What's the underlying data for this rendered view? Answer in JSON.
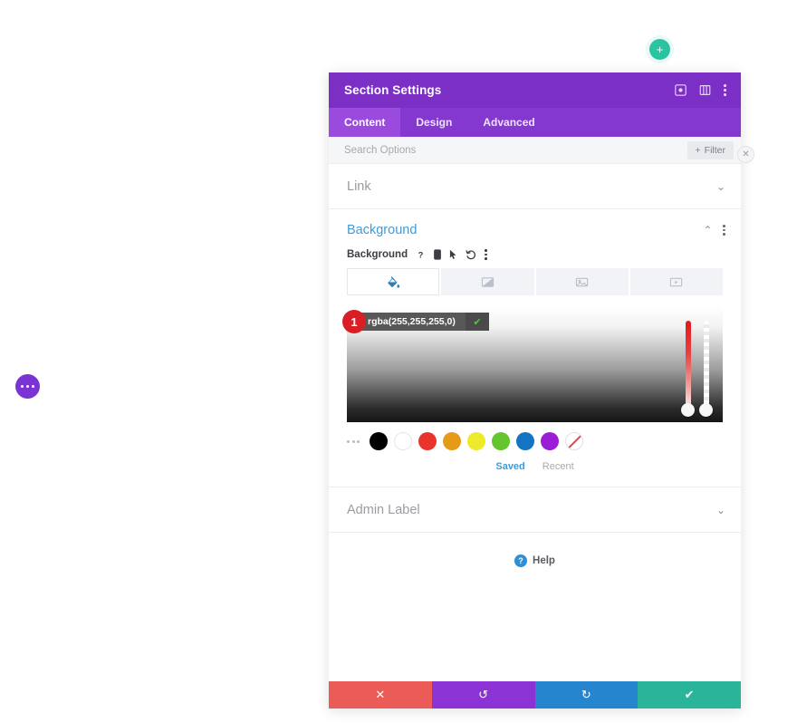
{
  "canvas": {
    "add_section_button": "+",
    "page_settings_button": "•••"
  },
  "modal": {
    "title": "Section Settings",
    "header_icons": [
      {
        "name": "focus-icon",
        "glyph": "target"
      },
      {
        "name": "layout-icon",
        "glyph": "panel"
      },
      {
        "name": "more-menu-icon",
        "glyph": "dots-vertical"
      }
    ],
    "close_button": "✕",
    "tabs": [
      {
        "label": "Content",
        "active": true
      },
      {
        "label": "Design",
        "active": false
      },
      {
        "label": "Advanced",
        "active": false
      }
    ],
    "search": {
      "placeholder": "Search Options",
      "value": "",
      "filter_label": "Filter",
      "filter_plus": "+"
    },
    "sections": {
      "link": {
        "label": "Link",
        "expanded": false,
        "chevron": "⌄"
      },
      "admin_label": {
        "label": "Admin Label",
        "expanded": false,
        "chevron": "⌄"
      },
      "background": {
        "label": "Background",
        "expanded": true,
        "chevron": "⌃",
        "field_label": "Background",
        "field_icons": [
          {
            "name": "help-icon",
            "glyph": "?"
          },
          {
            "name": "responsive-icon",
            "glyph": "mobile"
          },
          {
            "name": "hover-icon",
            "glyph": "cursor"
          },
          {
            "name": "reset-icon",
            "glyph": "undo"
          },
          {
            "name": "options-menu-icon",
            "glyph": "dots-vertical"
          }
        ],
        "types": [
          {
            "name": "background-color-tab",
            "icon": "paint-bucket-icon",
            "active": true
          },
          {
            "name": "background-gradient-tab",
            "icon": "gradient-icon",
            "active": false
          },
          {
            "name": "background-image-tab",
            "icon": "image-icon",
            "active": false
          },
          {
            "name": "background-video-tab",
            "icon": "video-icon",
            "active": false
          }
        ],
        "color_picker": {
          "value": "rgba(255,255,255,0)",
          "confirm": "✔",
          "step_badge": "1",
          "hue_slider_position_pct": 100,
          "alpha_slider_position_pct": 100,
          "swatches": [
            {
              "name": "swatch-black",
              "color": "#000000"
            },
            {
              "name": "swatch-white",
              "color": "#ffffff"
            },
            {
              "name": "swatch-red",
              "color": "#e8342c"
            },
            {
              "name": "swatch-orange",
              "color": "#e59b17"
            },
            {
              "name": "swatch-yellow",
              "color": "#edea2a"
            },
            {
              "name": "swatch-green",
              "color": "#62c githubusercontent"
            }
          ],
          "saved_tab": "Saved",
          "recent_tab": "Recent"
        }
      }
    },
    "help": {
      "label": "Help",
      "icon": "?"
    },
    "footer": [
      {
        "name": "cancel-button",
        "glyph": "✕",
        "color": "#eb5c58"
      },
      {
        "name": "undo-button",
        "glyph": "↺",
        "color": "#8b33d4"
      },
      {
        "name": "redo-button",
        "glyph": "↻",
        "color": "#2586cf"
      },
      {
        "name": "save-button",
        "glyph": "✔",
        "color": "#2ab49a"
      }
    ]
  },
  "swatch_colors": [
    "#000000",
    "#ffffff",
    "#e8342c",
    "#e59b17",
    "#edea2a",
    "#63c62e",
    "#1474c4",
    "#9b1ed6"
  ]
}
